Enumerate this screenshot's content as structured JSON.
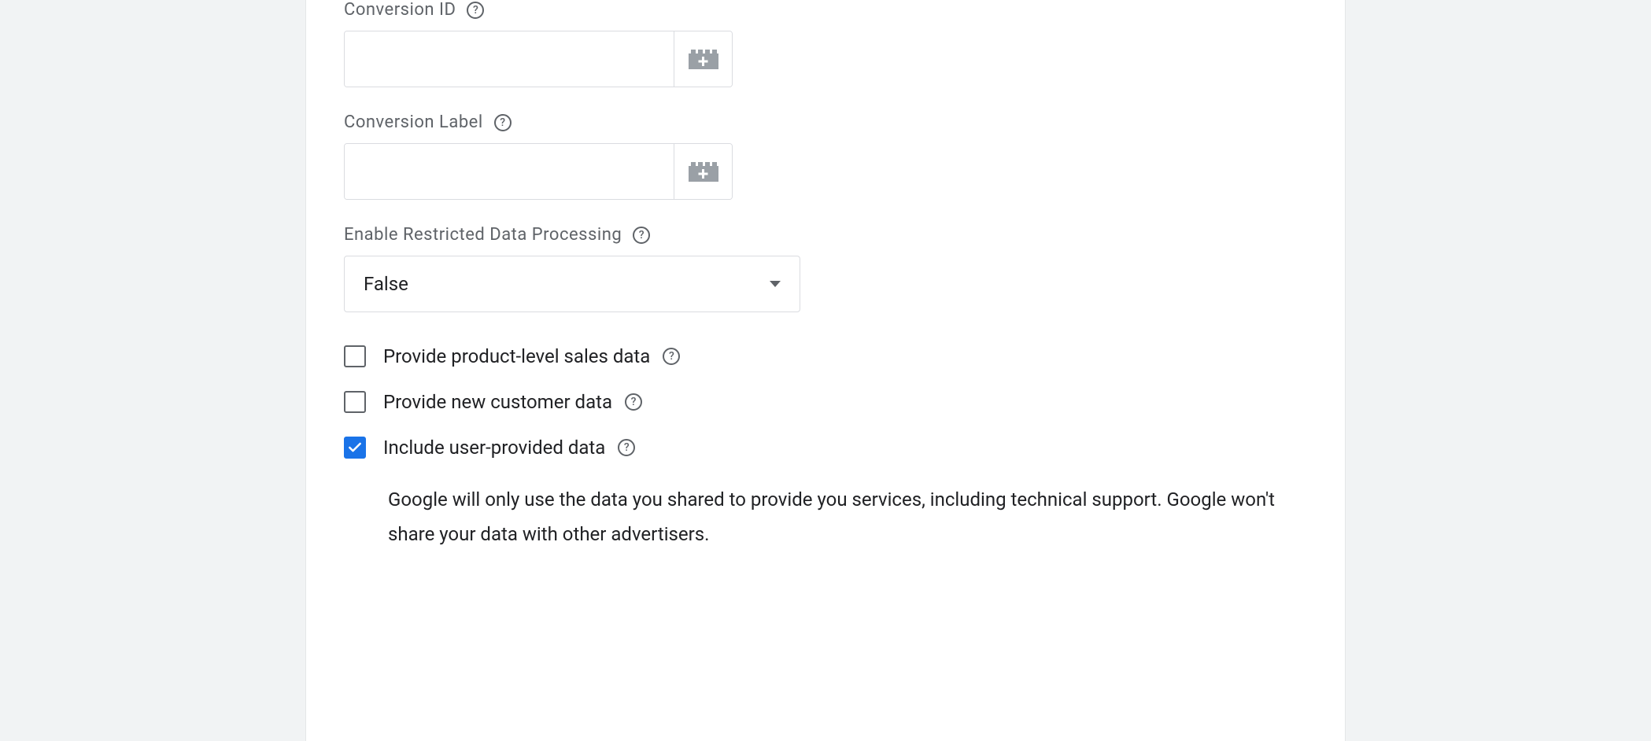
{
  "fields": {
    "conversion_id": {
      "label": "Conversion ID",
      "value": ""
    },
    "conversion_label": {
      "label": "Conversion Label",
      "value": ""
    },
    "restricted_data": {
      "label": "Enable Restricted Data Processing",
      "value": "False"
    }
  },
  "checkboxes": {
    "product_sales": {
      "label": "Provide product-level sales data",
      "checked": false
    },
    "new_customer": {
      "label": "Provide new customer data",
      "checked": false
    },
    "user_provided": {
      "label": "Include user-provided data",
      "checked": true,
      "description": "Google will only use the data you shared to provide you services, including technical support. Google won't share your data with other advertisers."
    }
  }
}
